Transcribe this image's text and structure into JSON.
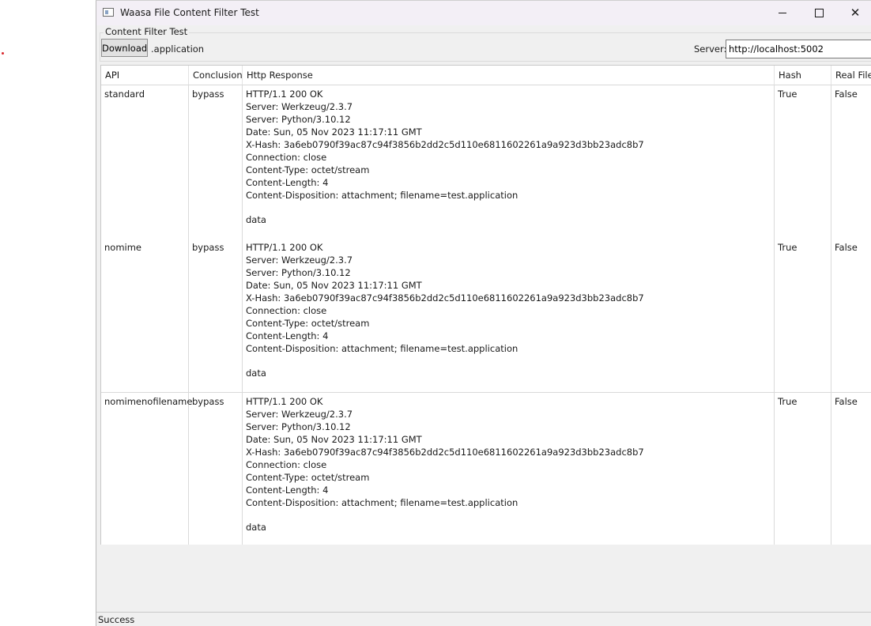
{
  "window": {
    "title": "Waasa File Content Filter Test",
    "minimize_icon": "minimize-icon",
    "maximize_icon": "maximize-icon",
    "close_icon": "close-icon",
    "close_glyph": "✕"
  },
  "toolbar": {
    "group_label": "Content Filter Test",
    "download_label": "Download",
    "extension": ".application",
    "server_label": "Server:",
    "server_value": "http://localhost:5002"
  },
  "grid": {
    "columns": [
      "API",
      "Conclusion",
      "Http Response",
      "Hash Check",
      "Real File"
    ],
    "rows": [
      {
        "api": "standard",
        "conclusion": "bypass",
        "response": [
          "HTTP/1.1 200 OK",
          "Server: Werkzeug/2.3.7",
          "Server: Python/3.10.12",
          "Date: Sun, 05 Nov 2023 11:17:11 GMT",
          "X-Hash: 3a6eb0790f39ac87c94f3856b2dd2c5d110e6811602261a9a923d3bb23adc8b7",
          "Connection: close",
          "Content-Type: octet/stream",
          "Content-Length: 4",
          "Content-Disposition: attachment; filename=test.application",
          "",
          "data"
        ],
        "hash_check": "True",
        "real_file": "False"
      },
      {
        "api": "nomime",
        "conclusion": "bypass",
        "response": [
          "HTTP/1.1 200 OK",
          "Server: Werkzeug/2.3.7",
          "Server: Python/3.10.12",
          "Date: Sun, 05 Nov 2023 11:17:11 GMT",
          "X-Hash: 3a6eb0790f39ac87c94f3856b2dd2c5d110e6811602261a9a923d3bb23adc8b7",
          "Connection: close",
          "Content-Type: octet/stream",
          "Content-Length: 4",
          "Content-Disposition: attachment; filename=test.application",
          "",
          "data"
        ],
        "hash_check": "True",
        "real_file": "False"
      },
      {
        "api": "nomimenofilename",
        "conclusion": "bypass",
        "response": [
          "HTTP/1.1 200 OK",
          "Server: Werkzeug/2.3.7",
          "Server: Python/3.10.12",
          "Date: Sun, 05 Nov 2023 11:17:11 GMT",
          "X-Hash: 3a6eb0790f39ac87c94f3856b2dd2c5d110e6811602261a9a923d3bb23adc8b7",
          "Connection: close",
          "Content-Type: octet/stream",
          "Content-Length: 4",
          "Content-Disposition: attachment; filename=test.application",
          "",
          "data"
        ],
        "hash_check": "True",
        "real_file": "False"
      }
    ]
  },
  "status": {
    "text": "Success"
  }
}
